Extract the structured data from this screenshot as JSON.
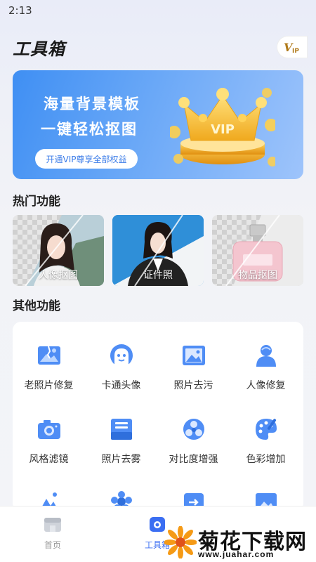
{
  "status": {
    "time": "2:13"
  },
  "header": {
    "title": "工具箱",
    "vip_badge": "VIP"
  },
  "banner": {
    "line1": "海量背景模板",
    "line2": "一键轻松抠图",
    "button": "开通VIP尊享全部权益",
    "crown_text": "VIP"
  },
  "hot": {
    "title": "热门功能",
    "items": [
      {
        "label": "人像抠图"
      },
      {
        "label": "证件照"
      },
      {
        "label": "物品抠图"
      }
    ]
  },
  "other": {
    "title": "其他功能",
    "tools": [
      {
        "label": "老照片修复",
        "icon": "old-photo-icon"
      },
      {
        "label": "卡通头像",
        "icon": "cartoon-avatar-icon"
      },
      {
        "label": "照片去污",
        "icon": "photo-clean-icon"
      },
      {
        "label": "人像修复",
        "icon": "portrait-repair-icon"
      },
      {
        "label": "风格滤镜",
        "icon": "camera-filter-icon"
      },
      {
        "label": "照片去雾",
        "icon": "dehaze-icon"
      },
      {
        "label": "对比度增强",
        "icon": "contrast-icon"
      },
      {
        "label": "色彩增加",
        "icon": "palette-icon"
      }
    ]
  },
  "tabbar": {
    "items": [
      {
        "label": "首页",
        "active": false
      },
      {
        "label": "工具箱",
        "active": true
      }
    ]
  },
  "watermark": {
    "text": "菊花下载网",
    "url": "www.juahar.com"
  },
  "colors": {
    "accent": "#3b7ce8",
    "icon_blue": "#4f8df5",
    "inactive": "#999999"
  }
}
